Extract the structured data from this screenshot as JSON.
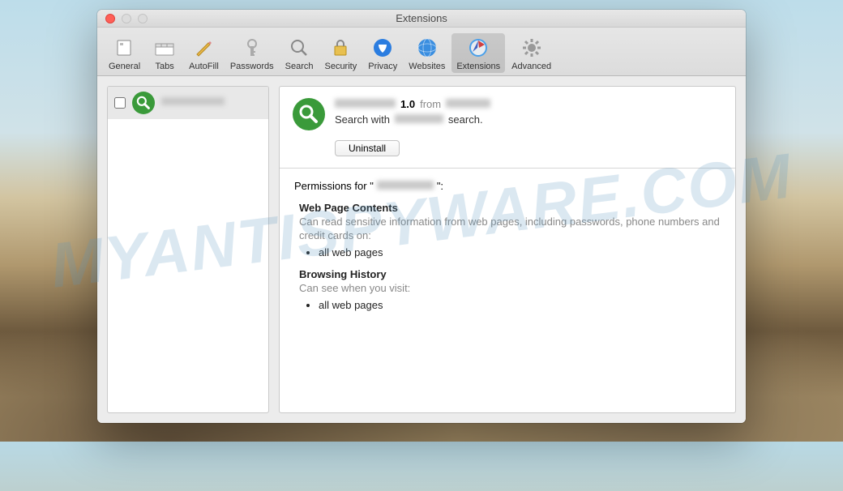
{
  "watermark": "MYANTISPYWARE.COM",
  "window": {
    "title": "Extensions"
  },
  "toolbar": {
    "tabs": [
      {
        "label": "General"
      },
      {
        "label": "Tabs"
      },
      {
        "label": "AutoFill"
      },
      {
        "label": "Passwords"
      },
      {
        "label": "Search"
      },
      {
        "label": "Security"
      },
      {
        "label": "Privacy"
      },
      {
        "label": "Websites"
      },
      {
        "label": "Extensions"
      },
      {
        "label": "Advanced"
      }
    ]
  },
  "sidebar": {
    "items": [
      {
        "checked": false
      }
    ]
  },
  "extension": {
    "version": "1.0",
    "from_label": "from",
    "desc_prefix": "Search with",
    "desc_suffix": "search.",
    "uninstall_label": "Uninstall"
  },
  "permissions": {
    "title_prefix": "Permissions for \"",
    "title_suffix": "\":",
    "blocks": [
      {
        "heading": "Web Page Contents",
        "desc": "Can read sensitive information from web pages, including passwords, phone numbers and credit cards on:",
        "items": [
          "all web pages"
        ]
      },
      {
        "heading": "Browsing History",
        "desc": "Can see when you visit:",
        "items": [
          "all web pages"
        ]
      }
    ]
  }
}
